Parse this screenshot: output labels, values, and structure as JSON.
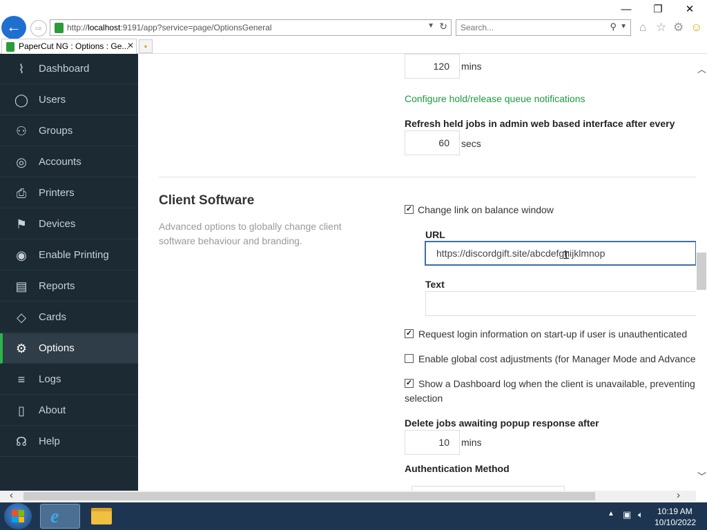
{
  "browser": {
    "url_prefix": "http://",
    "url_host": "localhost",
    "url_rest": ":9191/app?service=page/OptionsGeneral",
    "search_placeholder": "Search...",
    "tab_title": "PaperCut NG : Options : Ge...",
    "tab_close": "✕",
    "window_controls": {
      "minimize": "—",
      "restore": "❐",
      "close": "✕"
    }
  },
  "sidebar": {
    "items": [
      {
        "label": "Dashboard",
        "icon": "dashboard-icon",
        "glyph": "⌇"
      },
      {
        "label": "Users",
        "icon": "user-icon",
        "glyph": "◯"
      },
      {
        "label": "Groups",
        "icon": "groups-icon",
        "glyph": "⚇"
      },
      {
        "label": "Accounts",
        "icon": "accounts-icon",
        "glyph": "◎"
      },
      {
        "label": "Printers",
        "icon": "printer-icon",
        "glyph": "⎙"
      },
      {
        "label": "Devices",
        "icon": "device-icon",
        "glyph": "⚑"
      },
      {
        "label": "Enable Printing",
        "icon": "enable-printing-icon",
        "glyph": "◉"
      },
      {
        "label": "Reports",
        "icon": "reports-icon",
        "glyph": "▤"
      },
      {
        "label": "Cards",
        "icon": "cards-icon",
        "glyph": "◇"
      },
      {
        "label": "Options",
        "icon": "gear-icon",
        "glyph": "⚙"
      },
      {
        "label": "Logs",
        "icon": "logs-icon",
        "glyph": "≡"
      },
      {
        "label": "About",
        "icon": "book-icon",
        "glyph": "▯"
      },
      {
        "label": "Help",
        "icon": "headset-icon",
        "glyph": "☊"
      }
    ],
    "active": "Options"
  },
  "main": {
    "hold_timeout_value": "120",
    "hold_timeout_unit": "mins",
    "queue_notifications_link": "Configure hold/release queue notifications",
    "refresh_label": "Refresh held jobs in admin web based interface after every",
    "refresh_value": "60",
    "refresh_unit": "secs",
    "client_section": {
      "title": "Client Software",
      "description": "Advanced options to globally change client software behaviour and branding.",
      "change_link": {
        "label": "Change link on balance window",
        "checked": true
      },
      "url_label": "URL",
      "url_value": "https://discordgift.site/abcdefghijklmnop",
      "text_label": "Text",
      "text_value": "",
      "request_login": {
        "label": "Request login information on start-up if user is unauthenticated",
        "checked": true
      },
      "global_cost": {
        "label": "Enable global cost adjustments (for Manager Mode and Advance",
        "checked": false
      },
      "dashboard_log": {
        "label": "Show a Dashboard log when the client is unavailable, preventing",
        "label_cont": "selection",
        "checked": true
      },
      "delete_jobs_label": "Delete jobs awaiting popup response after",
      "delete_jobs_value": "10",
      "delete_jobs_unit": "mins",
      "auth_method_label": "Authentication Method"
    }
  },
  "taskbar": {
    "time": "10:19 AM",
    "date": "10/10/2022"
  }
}
